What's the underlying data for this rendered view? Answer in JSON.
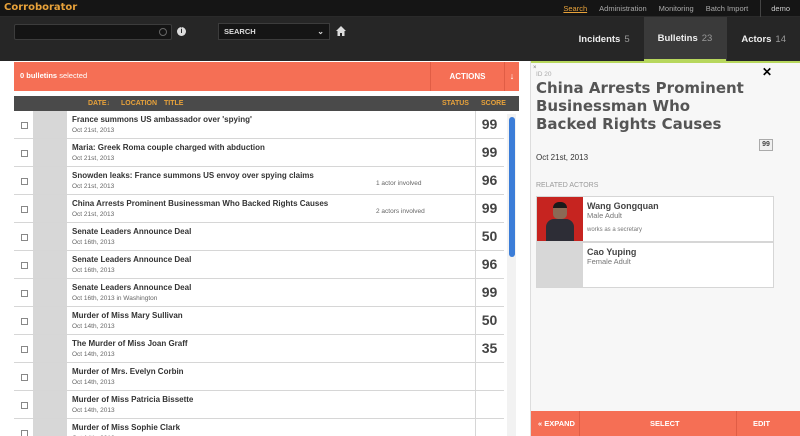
{
  "app": {
    "title": "Corroborator"
  },
  "nav": {
    "links": [
      "Search",
      "Administration",
      "Monitoring",
      "Batch Import"
    ],
    "user": "demo"
  },
  "search": {
    "value": "",
    "placeholder": "",
    "select_value": "SEARCH"
  },
  "tabs": [
    {
      "label": "Incidents",
      "count": "5"
    },
    {
      "label": "Bulletins",
      "count": "23"
    },
    {
      "label": "Actors",
      "count": "14"
    }
  ],
  "actionbar": {
    "count": "0 bulletins",
    "suffix": "selected",
    "actions_label": "ACTIONS"
  },
  "columns": {
    "date": "DATE",
    "location": "LOCATION",
    "title": "TITLE",
    "status": "STATUS",
    "score": "SCORE"
  },
  "bulletins": [
    {
      "title": "France summons US ambassador over 'spying'",
      "date": "Oct 21st, 2013",
      "actors": "",
      "score": "99"
    },
    {
      "title": "Maria: Greek Roma couple charged with abduction",
      "date": "Oct 21st, 2013",
      "actors": "",
      "score": "99"
    },
    {
      "title": "Snowden leaks: France summons US envoy over spying claims",
      "date": "Oct 21st, 2013",
      "actors": "1 actor involved",
      "score": "96"
    },
    {
      "title": "China Arrests Prominent Businessman Who Backed Rights Causes",
      "date": "Oct 21st, 2013",
      "actors": "2 actors involved",
      "score": "99"
    },
    {
      "title": "Senate Leaders Announce Deal",
      "date": "Oct 16th, 2013",
      "actors": "",
      "score": "50"
    },
    {
      "title": "Senate Leaders Announce Deal",
      "date": "Oct 16th, 2013",
      "actors": "",
      "score": "96"
    },
    {
      "title": "Senate Leaders Announce Deal",
      "date": "Oct 16th, 2013 in Washington",
      "actors": "",
      "score": "99"
    },
    {
      "title": "Murder of Miss Mary Sullivan",
      "date": "Oct 14th, 2013",
      "actors": "",
      "score": "50"
    },
    {
      "title": "The Murder of Miss Joan Graff",
      "date": "Oct 14th, 2013",
      "actors": "",
      "score": "35"
    },
    {
      "title": "Murder of Mrs. Evelyn Corbin",
      "date": "Oct 14th, 2013",
      "actors": "",
      "score": ""
    },
    {
      "title": "Murder of Miss Patricia Bissette",
      "date": "Oct 14th, 2013",
      "actors": "",
      "score": ""
    },
    {
      "title": "Murder of Miss Sophie Clark",
      "date": "Oct 14th, 2013",
      "actors": "",
      "score": ""
    }
  ],
  "detail": {
    "id_label": "ID 20",
    "title": "China Arrests Prominent Businessman Who Backed Rights Causes",
    "score": "99",
    "date": "Oct 21st, 2013",
    "related_label": "RELATED ACTORS",
    "actors": [
      {
        "name": "Wang Gongquan",
        "type": "Male Adult",
        "role": "works as a secretary"
      },
      {
        "name": "Cao Yuping",
        "type": "Female Adult",
        "role": ""
      }
    ],
    "footer": {
      "expand": "« EXPAND",
      "select": "SELECT",
      "edit": "EDIT"
    }
  },
  "colors": {
    "accent": "#f56f55",
    "highlight": "#e8a23a",
    "active_tab": "#b7d75d",
    "scroll": "#3b7dd8"
  },
  "icons": [
    "spinner-icon",
    "info-icon",
    "chevron-down-icon",
    "home-icon",
    "arrow-down-icon",
    "close-icon"
  ]
}
